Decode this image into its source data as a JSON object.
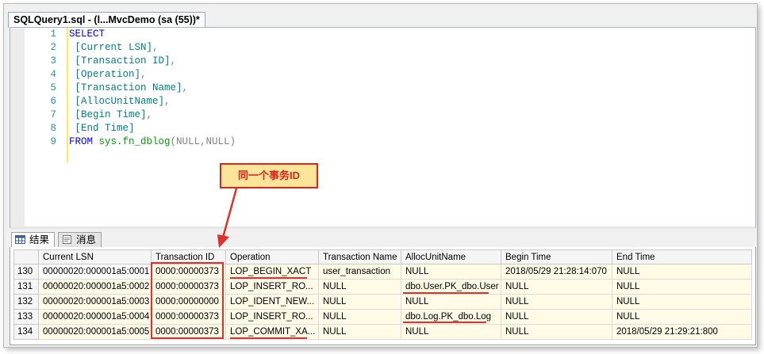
{
  "document_tab": {
    "title": "SQLQuery1.sql - (l...MvcDemo (sa (55))*"
  },
  "editor": {
    "lines": [
      {
        "num": "1",
        "tokens": [
          {
            "t": "SELECT",
            "c": "kw"
          }
        ]
      },
      {
        "num": "2",
        "tokens": [
          {
            "t": " [Current LSN]",
            "c": "br"
          },
          {
            "t": ",",
            "c": "gr"
          }
        ]
      },
      {
        "num": "3",
        "tokens": [
          {
            "t": " [Transaction ID]",
            "c": "br"
          },
          {
            "t": ",",
            "c": "gr"
          }
        ]
      },
      {
        "num": "4",
        "tokens": [
          {
            "t": " [Operation]",
            "c": "br"
          },
          {
            "t": ",",
            "c": "gr"
          }
        ]
      },
      {
        "num": "5",
        "tokens": [
          {
            "t": " [Transaction Name]",
            "c": "br"
          },
          {
            "t": ",",
            "c": "gr"
          }
        ]
      },
      {
        "num": "6",
        "tokens": [
          {
            "t": " [AllocUnitName]",
            "c": "br"
          },
          {
            "t": ",",
            "c": "gr"
          }
        ]
      },
      {
        "num": "7",
        "tokens": [
          {
            "t": " [Begin Time]",
            "c": "br"
          },
          {
            "t": ",",
            "c": "gr"
          }
        ]
      },
      {
        "num": "8",
        "tokens": [
          {
            "t": " [End Time]",
            "c": "br"
          }
        ]
      },
      {
        "num": "9",
        "tokens": [
          {
            "t": "FROM",
            "c": "kw"
          },
          {
            "t": " ",
            "c": ""
          },
          {
            "t": "sys.fn_dblog",
            "c": "fn"
          },
          {
            "t": "(NULL,NULL)",
            "c": "gr"
          }
        ]
      }
    ]
  },
  "callout": {
    "text": "同一个事务ID"
  },
  "result_tabs": {
    "results": "结果",
    "messages": "消息"
  },
  "grid": {
    "columns": [
      "Current LSN",
      "Transaction ID",
      "Operation",
      "Transaction Name",
      "AllocUnitName",
      "Begin Time",
      "End Time"
    ],
    "rows": [
      [
        "130",
        "00000020:000001a5:0001",
        "0000:00000373",
        "LOP_BEGIN_XACT",
        "user_transaction",
        "NULL",
        "2018/05/29 21:28:14:070",
        "NULL"
      ],
      [
        "131",
        "00000020:000001a5:0002",
        "0000:00000373",
        "LOP_INSERT_RO...",
        "NULL",
        "dbo.User.PK_dbo.User",
        "NULL",
        "NULL"
      ],
      [
        "132",
        "00000020:000001a5:0003",
        "0000:00000000",
        "LOP_IDENT_NEW...",
        "NULL",
        "NULL",
        "NULL",
        "NULL"
      ],
      [
        "133",
        "00000020:000001a5:0004",
        "0000:00000373",
        "LOP_INSERT_RO...",
        "NULL",
        "dbo.Log.PK_dbo.Log",
        "NULL",
        "NULL"
      ],
      [
        "134",
        "00000020:000001a5:0005",
        "0000:00000373",
        "LOP_COMMIT_XA...",
        "NULL",
        "NULL",
        "NULL",
        "2018/05/29 21:29:21:800"
      ]
    ]
  },
  "colors": {
    "annotation": "#e0302a",
    "callout_fill": "#fde49b",
    "keyword": "#0000ff",
    "bracket": "#008080",
    "function": "#00a000",
    "line_number": "#2b91af"
  }
}
